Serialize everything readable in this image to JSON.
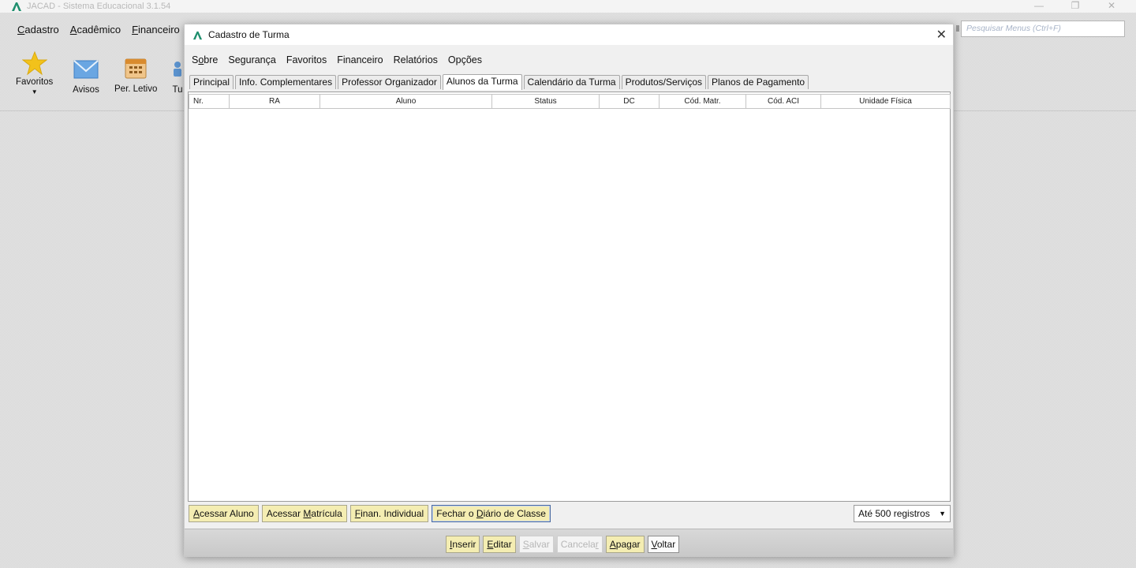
{
  "app": {
    "title": "JACAD - Sistema Educacional 3.1.54",
    "menu": [
      "Cadastro",
      "Acadêmico",
      "Financeiro"
    ],
    "toolbar": [
      {
        "label": "Favoritos",
        "icon": "star-icon"
      },
      {
        "label": "Avisos",
        "icon": "mail-icon"
      },
      {
        "label": "Per. Letivo",
        "icon": "calendar-icon"
      },
      {
        "label": "Tu",
        "icon": "turma-icon"
      }
    ],
    "search_placeholder": "Pesquisar Menus (Ctrl+F)",
    "window_controls": {
      "minimize": "—",
      "restore": "❐",
      "close": "✕"
    }
  },
  "dialog": {
    "title": "Cadastro de Turma",
    "close": "✕",
    "menu": [
      "Sobre",
      "Segurança",
      "Favoritos",
      "Financeiro",
      "Relatórios",
      "Opções"
    ],
    "tabs": [
      {
        "label": "Principal",
        "active": false
      },
      {
        "label": "Info. Complementares",
        "active": false
      },
      {
        "label": "Professor Organizador",
        "active": false
      },
      {
        "label": "Alunos da Turma",
        "active": true
      },
      {
        "label": "Calendário da Turma",
        "active": false
      },
      {
        "label": "Produtos/Serviços",
        "active": false
      },
      {
        "label": "Planos de Pagamento",
        "active": false
      }
    ],
    "table": {
      "columns": [
        "Nr.",
        "RA",
        "Aluno",
        "Status",
        "DC",
        "Cód. Matr.",
        "Cód. ACI",
        "Unidade Física"
      ],
      "rows": []
    },
    "bottom_buttons": {
      "acessar_aluno": "Acessar Aluno",
      "acessar_matricula": "Acessar Matrícula",
      "finan_individual": "Finan. Individual",
      "fechar_diario": "Fechar o Diário de Classe"
    },
    "records": "Até 500 registros",
    "actions": {
      "inserir": "Inserir",
      "editar": "Editar",
      "salvar": "Salvar",
      "cancelar": "Cancelar",
      "apagar": "Apagar",
      "voltar": "Voltar"
    }
  },
  "colors": {
    "button_yellow": "#f4edb2",
    "logo_green": "#1f8f6e"
  }
}
